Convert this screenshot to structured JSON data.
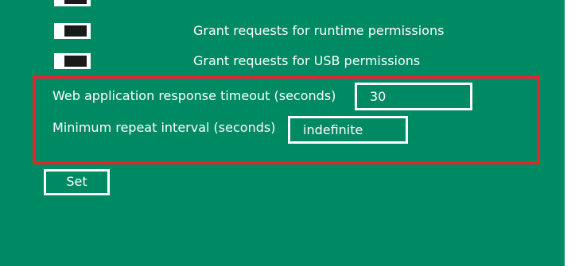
{
  "permissions": {
    "items": [
      {
        "label": "",
        "enabled": false
      },
      {
        "label": "Grant requests for runtime permissions",
        "enabled": false
      },
      {
        "label": "Grant requests for USB permissions",
        "enabled": false
      }
    ]
  },
  "settings": {
    "timeout_label": "Web application response timeout (seconds)",
    "timeout_value": "30",
    "interval_label": "Minimum repeat interval (seconds)",
    "interval_value": "indefinite"
  },
  "actions": {
    "set_label": "Set"
  },
  "colors": {
    "background": "#008a63",
    "highlight": "#e8232c",
    "foreground": "#ffffff",
    "toggle_knob": "#1a1a1a"
  }
}
